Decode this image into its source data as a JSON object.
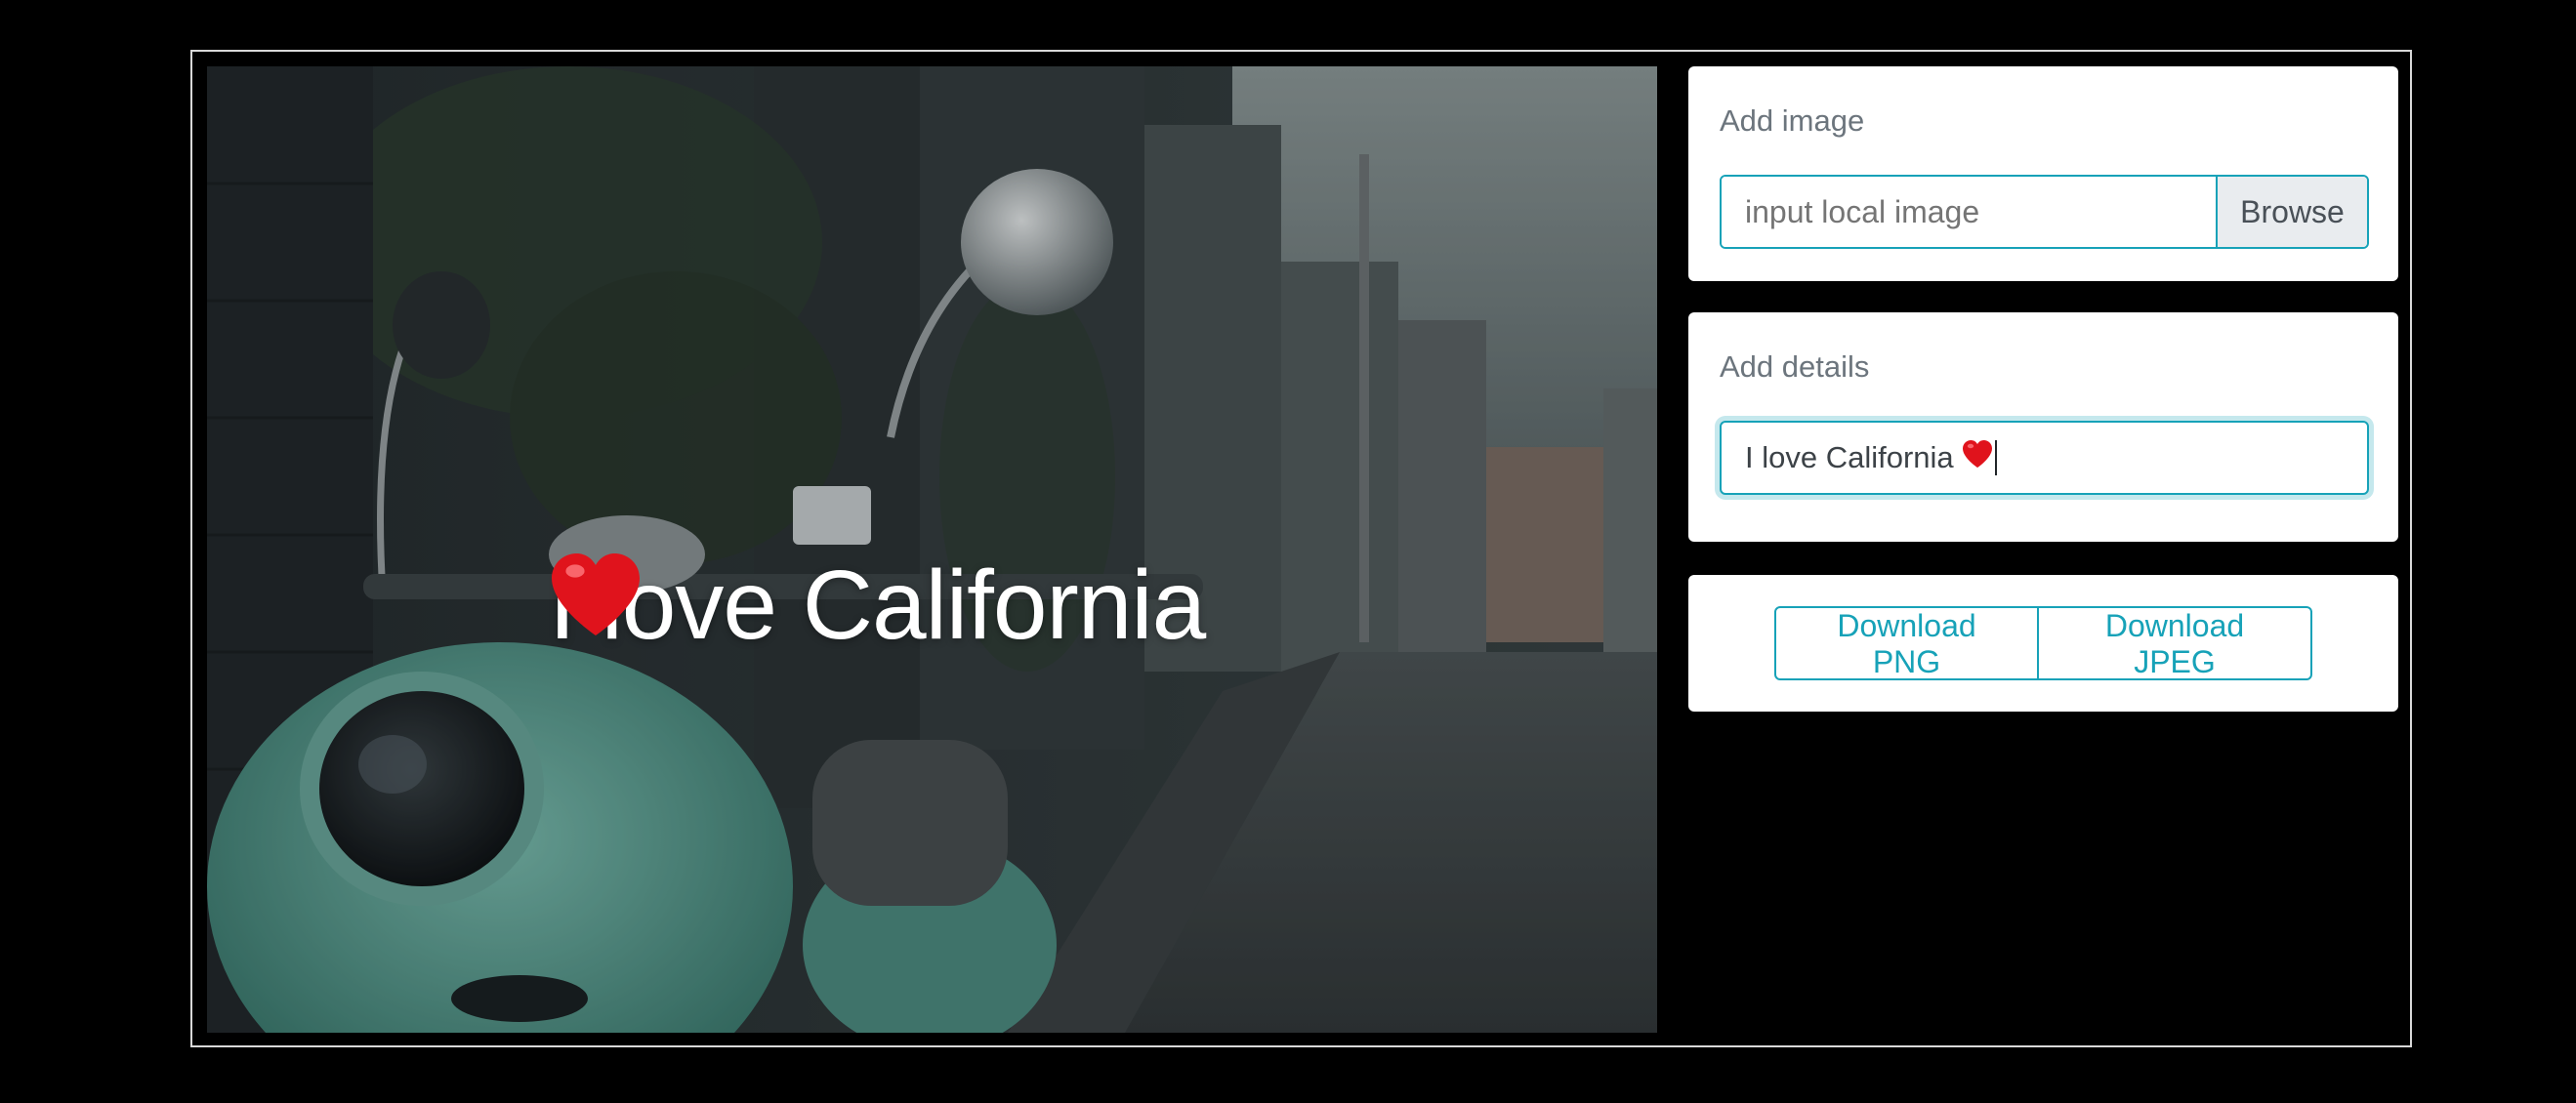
{
  "preview": {
    "overlay_text": "I love California",
    "overlay_emoji": "red-heart-icon"
  },
  "add_image": {
    "label": "Add image",
    "input_placeholder": "input local image",
    "browse_label": "Browse"
  },
  "add_details": {
    "label": "Add details",
    "input_value": "I love California"
  },
  "download": {
    "png_label": "Download PNG",
    "jpeg_label": "Download JPEG"
  },
  "colors": {
    "accent": "#17a2b8",
    "card_bg": "#ffffff",
    "page_bg": "#000000"
  }
}
